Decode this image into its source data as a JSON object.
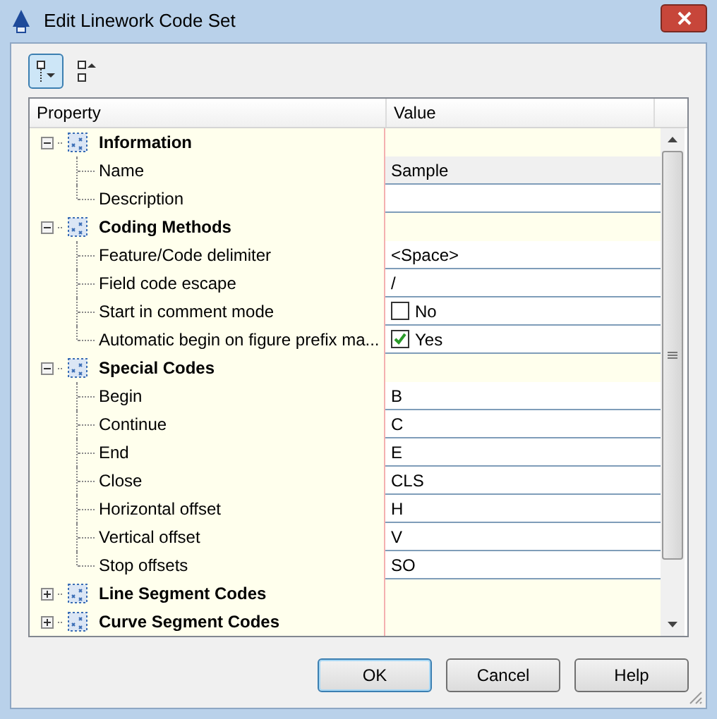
{
  "window": {
    "title": "Edit Linework Code Set"
  },
  "toolbar": [
    {
      "kind": "expand",
      "selected": true
    },
    {
      "kind": "collapse",
      "selected": false
    }
  ],
  "grid": {
    "columns": [
      "Property",
      "Value"
    ],
    "categories": [
      {
        "label": "Information",
        "expanded": true,
        "children": [
          {
            "label": "Name",
            "kind": "text",
            "value": "Sample",
            "read_only": true
          },
          {
            "label": "Description",
            "kind": "text",
            "read_only": false
          }
        ]
      },
      {
        "label": "Coding Methods",
        "expanded": true,
        "children": [
          {
            "label": "Feature/Code delimiter",
            "kind": "text",
            "value": "<Space>",
            "read_only": false
          },
          {
            "label": "Field code escape",
            "kind": "text",
            "value": "/",
            "read_only": false
          },
          {
            "label": "Start in comment mode",
            "kind": "checkbox",
            "value": "No",
            "checked": false
          },
          {
            "label": "Automatic begin on figure prefix ma...",
            "kind": "checkbox",
            "value": "Yes",
            "checked": true
          }
        ]
      },
      {
        "label": "Special Codes",
        "expanded": true,
        "children": [
          {
            "label": "Begin",
            "kind": "text",
            "value": "B",
            "read_only": false
          },
          {
            "label": "Continue",
            "kind": "text",
            "value": "C",
            "read_only": false
          },
          {
            "label": "End",
            "kind": "text",
            "value": "E",
            "read_only": false
          },
          {
            "label": "Close",
            "kind": "text",
            "value": "CLS",
            "read_only": false
          },
          {
            "label": "Horizontal offset",
            "kind": "text",
            "value": "H",
            "read_only": false
          },
          {
            "label": "Vertical offset",
            "kind": "text",
            "value": "V",
            "read_only": false
          },
          {
            "label": "Stop offsets",
            "kind": "text",
            "value": "SO",
            "read_only": false
          }
        ]
      },
      {
        "label": "Line Segment Codes",
        "expanded": false
      },
      {
        "label": "Curve Segment Codes",
        "expanded": false
      }
    ]
  },
  "buttons": [
    {
      "label": "OK",
      "default": true
    },
    {
      "label": "Cancel",
      "default": false
    },
    {
      "label": "Help",
      "default": false
    }
  ]
}
